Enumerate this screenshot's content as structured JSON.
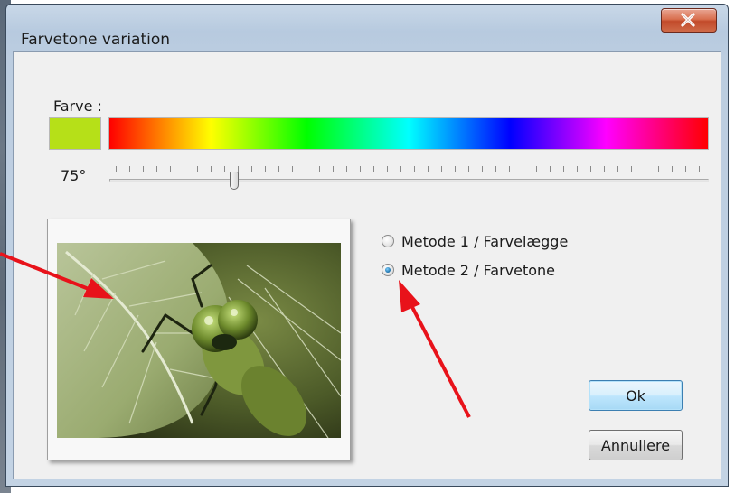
{
  "window": {
    "title": "Farvetone variation",
    "close_icon": "close-icon"
  },
  "color": {
    "label": "Farve :",
    "swatch_color": "#b6e018",
    "hue_spectrum": [
      "#ff0000",
      "#ffff00",
      "#00ff00",
      "#00ffff",
      "#0000ff",
      "#ff00ff",
      "#ff0000"
    ]
  },
  "slider": {
    "value_label": "75°",
    "value_degrees": 75,
    "max_degrees": 360
  },
  "preview": {
    "image": "dragonfly-on-leaf-green-tinted"
  },
  "methods": {
    "options": [
      {
        "label": "Metode 1 / Farvelægge",
        "checked": false
      },
      {
        "label": "Metode 2 / Farvetone",
        "checked": true
      }
    ]
  },
  "buttons": {
    "ok_label": "Ok",
    "cancel_label": "Annullere"
  },
  "annotations": {
    "arrow_color": "#e8121a"
  }
}
